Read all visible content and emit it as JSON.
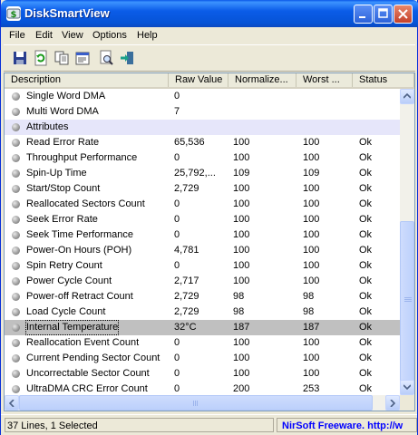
{
  "window": {
    "title": "DiskSmartView"
  },
  "menu": [
    "File",
    "Edit",
    "View",
    "Options",
    "Help"
  ],
  "toolbar": {
    "icons": [
      "save-icon",
      "refresh-icon",
      "copy-icon",
      "properties-icon",
      "find-icon",
      "exit-icon"
    ]
  },
  "columns": [
    "Description",
    "Raw Value",
    "Normalize...",
    "Worst ...",
    "Status"
  ],
  "rows": [
    {
      "desc": "Single Word DMA",
      "raw": "0",
      "norm": "",
      "worst": "",
      "status": ""
    },
    {
      "desc": "Multi Word DMA",
      "raw": "7",
      "norm": "",
      "worst": "",
      "status": ""
    },
    {
      "desc": "Attributes",
      "raw": "",
      "norm": "",
      "worst": "",
      "status": "",
      "group": true
    },
    {
      "desc": "Read Error Rate",
      "raw": "65,536",
      "norm": "100",
      "worst": "100",
      "status": "Ok"
    },
    {
      "desc": "Throughput Performance",
      "raw": "0",
      "norm": "100",
      "worst": "100",
      "status": "Ok"
    },
    {
      "desc": "Spin-Up Time",
      "raw": "25,792,...",
      "norm": "109",
      "worst": "109",
      "status": "Ok"
    },
    {
      "desc": "Start/Stop Count",
      "raw": "2,729",
      "norm": "100",
      "worst": "100",
      "status": "Ok"
    },
    {
      "desc": "Reallocated Sectors Count",
      "raw": "0",
      "norm": "100",
      "worst": "100",
      "status": "Ok"
    },
    {
      "desc": "Seek Error Rate",
      "raw": "0",
      "norm": "100",
      "worst": "100",
      "status": "Ok"
    },
    {
      "desc": "Seek Time Performance",
      "raw": "0",
      "norm": "100",
      "worst": "100",
      "status": "Ok"
    },
    {
      "desc": "Power-On Hours (POH)",
      "raw": "4,781",
      "norm": "100",
      "worst": "100",
      "status": "Ok"
    },
    {
      "desc": "Spin Retry Count",
      "raw": "0",
      "norm": "100",
      "worst": "100",
      "status": "Ok"
    },
    {
      "desc": "Power Cycle Count",
      "raw": "2,717",
      "norm": "100",
      "worst": "100",
      "status": "Ok"
    },
    {
      "desc": "Power-off Retract Count",
      "raw": "2,729",
      "norm": "98",
      "worst": "98",
      "status": "Ok"
    },
    {
      "desc": "Load Cycle Count",
      "raw": "2,729",
      "norm": "98",
      "worst": "98",
      "status": "Ok"
    },
    {
      "desc": "Internal Temperature",
      "raw": "32°C",
      "norm": "187",
      "worst": "187",
      "status": "Ok",
      "selected": true
    },
    {
      "desc": "Reallocation Event Count",
      "raw": "0",
      "norm": "100",
      "worst": "100",
      "status": "Ok"
    },
    {
      "desc": "Current Pending Sector Count",
      "raw": "0",
      "norm": "100",
      "worst": "100",
      "status": "Ok"
    },
    {
      "desc": "Uncorrectable Sector Count",
      "raw": "0",
      "norm": "100",
      "worst": "100",
      "status": "Ok"
    },
    {
      "desc": "UltraDMA CRC Error Count",
      "raw": "0",
      "norm": "200",
      "worst": "253",
      "status": "Ok"
    }
  ],
  "statusbar": {
    "count": "37 Lines, 1 Selected",
    "link": "NirSoft Freeware.  http://w"
  },
  "colors": {
    "title_bar": "#0653d6",
    "selection": "#c0c0c0",
    "group_row": "#e6e6fa",
    "link": "#0000ff"
  }
}
